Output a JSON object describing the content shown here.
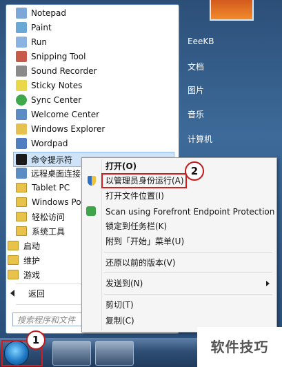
{
  "programs": [
    {
      "label": "Notepad",
      "icon": "notepad-icon",
      "color": "#7da7d9"
    },
    {
      "label": "Paint",
      "icon": "paint-icon",
      "color": "#6aa8d6"
    },
    {
      "label": "Run",
      "icon": "run-icon",
      "color": "#8ab3e1"
    },
    {
      "label": "Snipping Tool",
      "icon": "scissors-icon",
      "color": "#c85a4a"
    },
    {
      "label": "Sound Recorder",
      "icon": "microphone-icon",
      "color": "#8a8a8a"
    },
    {
      "label": "Sticky Notes",
      "icon": "sticky-note-icon",
      "color": "#e9d84a"
    },
    {
      "label": "Sync Center",
      "icon": "sync-icon",
      "color": "#3ea84a"
    },
    {
      "label": "Welcome Center",
      "icon": "welcome-icon",
      "color": "#5b8cc4"
    },
    {
      "label": "Windows Explorer",
      "icon": "explorer-folder-icon",
      "color": "#e7c14e"
    },
    {
      "label": "Wordpad",
      "icon": "wordpad-icon",
      "color": "#4f7fc1"
    },
    {
      "label": "命令提示符",
      "icon": "command-prompt-icon",
      "color": "#1b1b1b"
    },
    {
      "label": "远程桌面连接",
      "icon": "remote-desktop-icon",
      "color": "#5b8cc4"
    }
  ],
  "folders": [
    "Tablet PC",
    "Windows Po",
    "轻松访问",
    "系统工具",
    "启动",
    "维护",
    "游戏"
  ],
  "back_label": "返回",
  "search_placeholder": "搜索程序和文件",
  "right_items": [
    "EeeKB",
    "文档",
    "图片",
    "音乐",
    "计算机"
  ],
  "context_menu": {
    "open": "打开(O)",
    "run_as_admin": "以管理员身份运行(A)",
    "open_location": "打开文件位置(I)",
    "scan": "Scan using Forefront Endpoint Protection",
    "pin_taskbar": "锁定到任务栏(K)",
    "pin_start": "附到「开始」菜单(U)",
    "restore": "还原以前的版本(V)",
    "send_to": "发送到(N)",
    "cut": "剪切(T)",
    "copy": "复制(C)"
  },
  "callouts": {
    "one": "1",
    "two": "2"
  },
  "watermark": "软件技巧",
  "colors": {
    "highlight": "#d11d1d",
    "selection": "#cfe3f8"
  }
}
